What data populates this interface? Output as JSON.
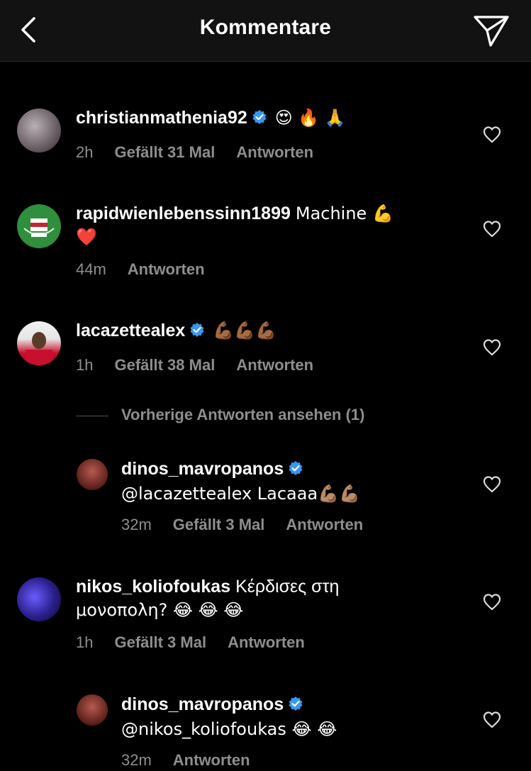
{
  "header": {
    "title": "Kommentare"
  },
  "comments": [
    {
      "username": "christianmathenia92",
      "verified": true,
      "text": "😍 🔥 🙏",
      "time": "2h",
      "likes": "Gefällt 31 Mal",
      "reply": "Antworten"
    },
    {
      "username": "rapidwienlebenssinn1899",
      "verified": false,
      "text": "Machine 💪",
      "text2": "❤️",
      "time": "44m",
      "likes": "",
      "reply": "Antworten"
    },
    {
      "username": "lacazettealex",
      "verified": true,
      "text": "💪🏾💪🏾💪🏾",
      "time": "1h",
      "likes": "Gefällt 38 Mal",
      "reply": "Antworten"
    },
    {
      "username": "dinos_mavropanos",
      "verified": true,
      "text": "@lacazettealex Lacaaa💪🏽💪🏽",
      "time": "32m",
      "likes": "Gefällt 3 Mal",
      "reply": "Antworten"
    },
    {
      "username": "nikos_koliofoukas",
      "verified": false,
      "text": "Κέρδισες στη",
      "text2": "μονοπολη? 😂 😂 😂",
      "time": "1h",
      "likes": "Gefällt 3 Mal",
      "reply": "Antworten"
    },
    {
      "username": "dinos_mavropanos",
      "verified": true,
      "text": "@nikos_koliofoukas 😂 😂",
      "time": "32m",
      "likes": "",
      "reply": "Antworten"
    }
  ],
  "view_replies": "Vorherige Antworten ansehen (1)"
}
